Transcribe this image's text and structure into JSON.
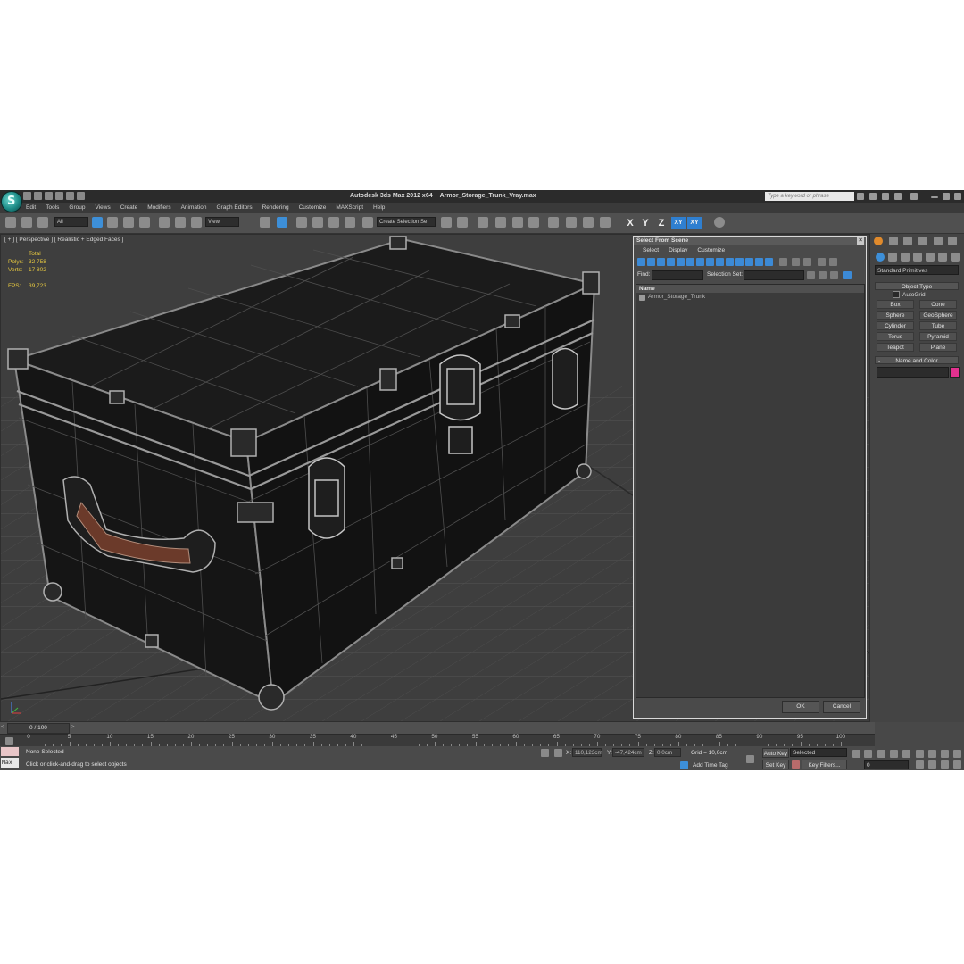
{
  "app": {
    "title": "Autodesk 3ds Max  2012 x64",
    "file": "Armor_Storage_Trunk_Vray.max",
    "search_placeholder": "Type a keyword or phrase",
    "menu": [
      "Edit",
      "Tools",
      "Group",
      "Views",
      "Create",
      "Modifiers",
      "Animation",
      "Graph Editors",
      "Rendering",
      "Customize",
      "MAXScript",
      "Help"
    ]
  },
  "toolbar": {
    "filter": "All",
    "ref_coord": "View",
    "selection_set": "Create Selection Se",
    "axes": [
      "X",
      "Y",
      "Z",
      "XY",
      "XY"
    ]
  },
  "viewport": {
    "label": "[ + ] [ Perspective ] [ Realistic + Edged Faces ]",
    "stats": {
      "header": "Total",
      "polys_label": "Polys:",
      "polys": "32 758",
      "verts_label": "Verts:",
      "verts": "17 802",
      "fps_label": "FPS:",
      "fps": "39,723"
    }
  },
  "dialog": {
    "title": "Select From Scene",
    "menu": [
      "Select",
      "Display",
      "Customize"
    ],
    "find_label": "Find:",
    "selection_set_label": "Selection Set:",
    "column_header": "Name",
    "items": [
      "Armor_Storage_Trunk"
    ],
    "ok": "OK",
    "cancel": "Cancel"
  },
  "command_panel": {
    "category": "Standard Primitives",
    "object_type_title": "Object Type",
    "autogrid": "AutoGrid",
    "buttons": [
      "Box",
      "Cone",
      "Sphere",
      "GeoSphere",
      "Cylinder",
      "Tube",
      "Torus",
      "Pyramid",
      "Teapot",
      "Plane"
    ],
    "name_color_title": "Name and Color",
    "color": "#e2318f"
  },
  "timeline": {
    "slider": "0 / 100",
    "ticks": [
      "0",
      "5",
      "10",
      "15",
      "20",
      "25",
      "30",
      "35",
      "40",
      "45",
      "50",
      "55",
      "60",
      "65",
      "70",
      "75",
      "80",
      "85",
      "90",
      "95",
      "100"
    ]
  },
  "status": {
    "maxscript": "Max",
    "selection": "None Selected",
    "prompt": "Click or click-and-drag to select objects",
    "x_label": "X:",
    "x": "110,123cm",
    "y_label": "Y:",
    "y": "-47,424cm",
    "z_label": "Z:",
    "z": "0,0cm",
    "grid": "Grid = 10,0cm",
    "add_time_tag": "Add Time Tag",
    "auto_key": "Auto Key",
    "set_key": "Set Key",
    "key_mode": "Selected",
    "key_filters": "Key Filters...",
    "frame": "0"
  }
}
